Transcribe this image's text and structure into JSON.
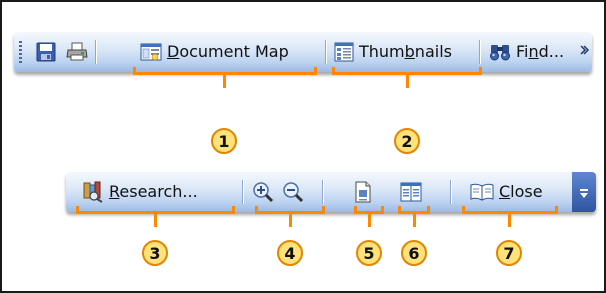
{
  "toolbar_top": {
    "document_map_label": "Document Map",
    "thumbnails_label": "Thumbnails",
    "find_label": "Find..."
  },
  "toolbar_bottom": {
    "research_label": "Research...",
    "close_label": "Close"
  },
  "callouts": [
    "1",
    "2",
    "3",
    "4",
    "5",
    "6",
    "7"
  ],
  "colors": {
    "callout_line": "#ff8800",
    "callout_fill": "#ffe27a",
    "toolbar_light": "#dde9f8",
    "toolbar_dark": "#9db9e3"
  },
  "icons": [
    "grip-handle",
    "save-icon",
    "print-icon",
    "document-map-icon",
    "thumbnails-icon",
    "binoculars-icon",
    "chevron-icon",
    "research-icon",
    "zoom-in-icon",
    "zoom-out-icon",
    "one-page-icon",
    "two-pages-icon",
    "book-icon",
    "toolbar-options-icon"
  ]
}
